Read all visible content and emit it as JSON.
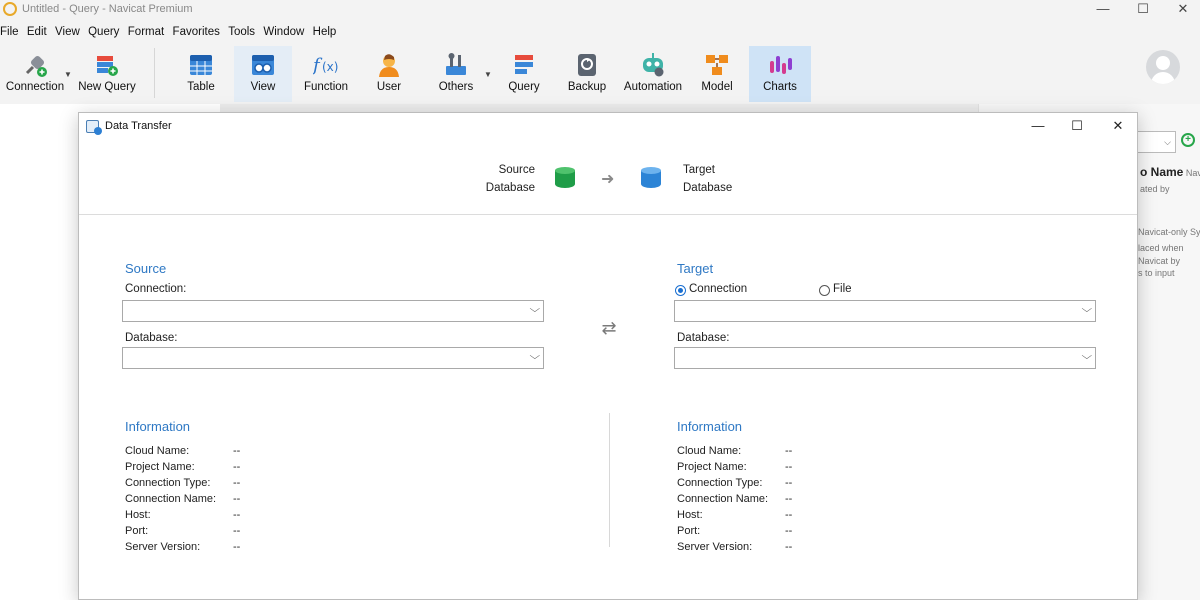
{
  "app": {
    "title": "Untitled - Query - Navicat Premium",
    "menu": [
      "File",
      "Edit",
      "View",
      "Query",
      "Format",
      "Favorites",
      "Tools",
      "Window",
      "Help"
    ]
  },
  "toolbar": {
    "items": [
      {
        "label": "Connection",
        "icon": "connection-plug-icon",
        "dropdown": true
      },
      {
        "label": "New Query",
        "icon": "new-query-icon"
      },
      {
        "label": "Table",
        "icon": "table-icon"
      },
      {
        "label": "View",
        "icon": "view-icon",
        "state": "hovered"
      },
      {
        "label": "Function",
        "icon": "function-icon"
      },
      {
        "label": "User",
        "icon": "user-icon"
      },
      {
        "label": "Others",
        "icon": "tools-icon",
        "dropdown": true
      },
      {
        "label": "Query",
        "icon": "query-icon"
      },
      {
        "label": "Backup",
        "icon": "backup-icon"
      },
      {
        "label": "Automation",
        "icon": "robot-icon"
      },
      {
        "label": "Model",
        "icon": "model-icon"
      },
      {
        "label": "Charts",
        "icon": "charts-icon",
        "state": "selected"
      }
    ]
  },
  "right_panel": {
    "heading": "o Name",
    "heading_suffix": "Navi",
    "lines": [
      "ated by",
      "Navicat-only Syn",
      "laced when",
      "Navicat by",
      "s to input"
    ]
  },
  "dialog": {
    "title": "Data Transfer",
    "header": {
      "source_line1": "Source",
      "source_line2": "Database",
      "target_line1": "Target",
      "target_line2": "Database"
    },
    "source": {
      "title": "Source",
      "connection_label": "Connection:",
      "connection_value": "",
      "database_label": "Database:",
      "database_value": ""
    },
    "target": {
      "title": "Target",
      "radio_connection": "Connection",
      "radio_file": "File",
      "selected": "Connection",
      "connection_value": "",
      "database_label": "Database:",
      "database_value": ""
    },
    "info_title": "Information",
    "info_labels": [
      "Cloud Name:",
      "Project Name:",
      "Connection Type:",
      "Connection Name:",
      "Host:",
      "Port:",
      "Server Version:"
    ],
    "source_info_values": [
      "--",
      "--",
      "--",
      "--",
      "--",
      "--",
      "--"
    ],
    "target_info_values": [
      "--",
      "--",
      "--",
      "--",
      "--",
      "--",
      "--"
    ]
  },
  "colors": {
    "accent": "#2e78c4",
    "selected_tool_bg": "#cfe3f6",
    "source_db": "#1f9d48",
    "target_db": "#2c84d6"
  }
}
